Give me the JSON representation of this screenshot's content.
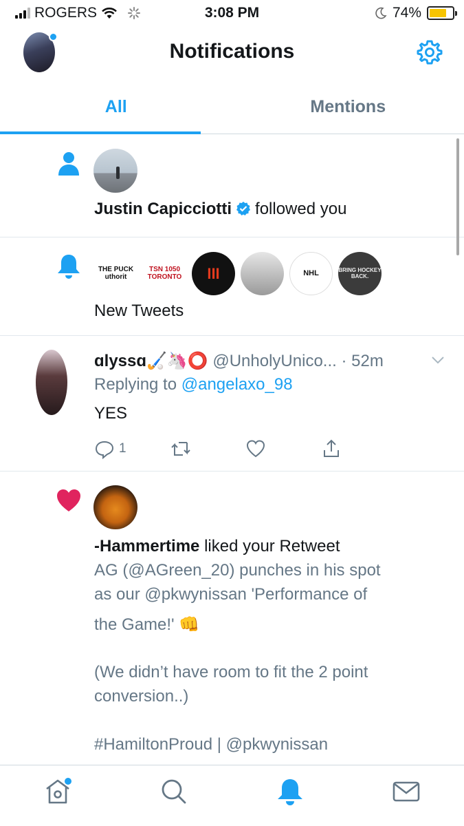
{
  "status_bar": {
    "carrier": "ROGERS",
    "time": "3:08 PM",
    "battery_percent": "74%",
    "battery_level": 0.74
  },
  "header": {
    "title": "Notifications"
  },
  "tabs": [
    {
      "label": "All",
      "active": true
    },
    {
      "label": "Mentions",
      "active": false
    }
  ],
  "notifications": {
    "follow": {
      "user": "Justin Capicciotti",
      "action": "followed you"
    },
    "new_tweets": {
      "label": "New Tweets",
      "accounts": [
        {
          "logo_text": "THE PUCK uthorit",
          "color": "#ffffff"
        },
        {
          "logo_text": "TSN 1050 TORONTO",
          "color": "#ffffff"
        },
        {
          "logo_text": "III",
          "color": "#111111"
        },
        {
          "logo_text": "",
          "color": "#d9d9d9"
        },
        {
          "logo_text": "NHL",
          "color": "#ffffff"
        },
        {
          "logo_text": "BRING HOCKEY BACK.",
          "color": "#3b3b3b"
        }
      ]
    },
    "tweet": {
      "display_name": "ɑlyssɑ🏑🦄⭕",
      "handle": "@UnholyUnico...",
      "time": "· 52m",
      "replying_prefix": "Replying to",
      "replying_to": "@angelaxo_98",
      "text": "YES",
      "reply_count": "1"
    },
    "like": {
      "user": "-Hammertime",
      "action": "liked your Retweet",
      "tweet_line1": "AG (@AGreen_20) punches in his spot",
      "tweet_line2": "as our @pkwynissan 'Performance of",
      "tweet_line3": "the Game!' 👊",
      "tweet_line4": "(We didn’t have room to fit the 2 point",
      "tweet_line5": "conversion..)",
      "tweet_line6": "#HamiltonProud | @pkwynissan"
    }
  },
  "bottom_nav": [
    {
      "icon": "home-icon"
    },
    {
      "icon": "search-icon"
    },
    {
      "icon": "bell-icon",
      "active": true
    },
    {
      "icon": "mail-icon"
    }
  ],
  "colors": {
    "accent": "#1da1f2",
    "text": "#14171a",
    "secondary": "#657786",
    "like": "#e0245e"
  }
}
